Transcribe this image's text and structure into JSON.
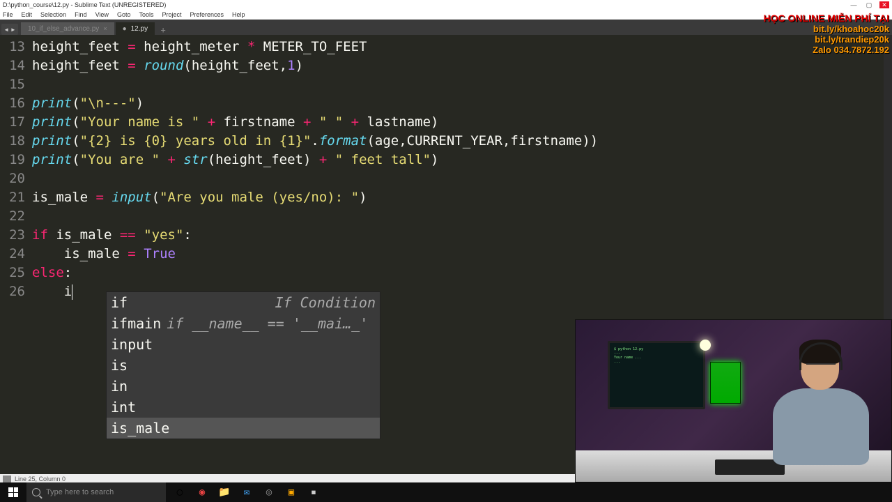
{
  "window": {
    "title": "D:\\python_course\\12.py - Sublime Text (UNREGISTERED)"
  },
  "menu": {
    "items": [
      "File",
      "Edit",
      "Selection",
      "Find",
      "View",
      "Goto",
      "Tools",
      "Project",
      "Preferences",
      "Help"
    ]
  },
  "tabs": {
    "prev": {
      "label": "10_if_else_advance.py"
    },
    "active": {
      "label": "12.py"
    }
  },
  "lines": {
    "13": "13",
    "14": "14",
    "15": "15",
    "16": "16",
    "17": "17",
    "18": "18",
    "19": "19",
    "20": "20",
    "21": "21",
    "22": "22",
    "23": "23",
    "24": "24",
    "25": "25",
    "26": "26"
  },
  "code": {
    "l13": {
      "a": "height_feet ",
      "b": "=",
      "c": " height_meter ",
      "d": "*",
      "e": " METER_TO_FEET"
    },
    "l14": {
      "a": "height_feet ",
      "b": "=",
      "c": " ",
      "d": "round",
      "e": "(height_feet,",
      "f": "1",
      "g": ")"
    },
    "l16": {
      "a": "print",
      "b": "(",
      "c": "\"\\n---\"",
      "d": ")"
    },
    "l17": {
      "a": "print",
      "b": "(",
      "c": "\"Your name is \"",
      "d": " + ",
      "e": "firstname",
      "f": " + ",
      "g": "\" \"",
      "h": " + ",
      "i": "lastname)"
    },
    "l18": {
      "a": "print",
      "b": "(",
      "c": "\"{2} is {0} years old in {1}\"",
      "d": ".",
      "e": "format",
      "f": "(age,CURRENT_YEAR,firstname))"
    },
    "l19": {
      "a": "print",
      "b": "(",
      "c": "\"You are \"",
      "d": " + ",
      "e": "str",
      "f": "(height_feet)",
      "g": " + ",
      "h": "\" feet tall\"",
      "i": ")"
    },
    "l21": {
      "a": "is_male ",
      "b": "=",
      "c": " ",
      "d": "input",
      "e": "(",
      "f": "\"Are you male (yes/no): \"",
      "g": ")"
    },
    "l23": {
      "a": "if",
      "b": " is_male ",
      "c": "==",
      "d": " ",
      "e": "\"yes\"",
      "f": ":"
    },
    "l24": {
      "a": "    is_male ",
      "b": "=",
      "c": " ",
      "d": "True"
    },
    "l25": {
      "a": "else",
      "b": ":"
    },
    "l26": {
      "a": "    i"
    }
  },
  "autocomplete": {
    "items": [
      {
        "main": "if",
        "hint": "If Condition"
      },
      {
        "main": "ifmain",
        "snip": "if __name__ == '__mai…_'"
      },
      {
        "main": "input",
        "hint": ""
      },
      {
        "main": "is",
        "hint": ""
      },
      {
        "main": "in",
        "hint": ""
      },
      {
        "main": "int",
        "hint": ""
      },
      {
        "main": "is_male",
        "hint": "",
        "selected": true
      }
    ]
  },
  "status": {
    "text": "Line 25, Column 0"
  },
  "search": {
    "placeholder": "Type here to search"
  },
  "banner": {
    "header": "HỌC ONLINE MIỄN PHÍ TẠI",
    "line1": "bit.ly/khoahoc20k",
    "line2": "bit.ly/trandiep20k",
    "line3": "Zalo 034.7872.192"
  }
}
